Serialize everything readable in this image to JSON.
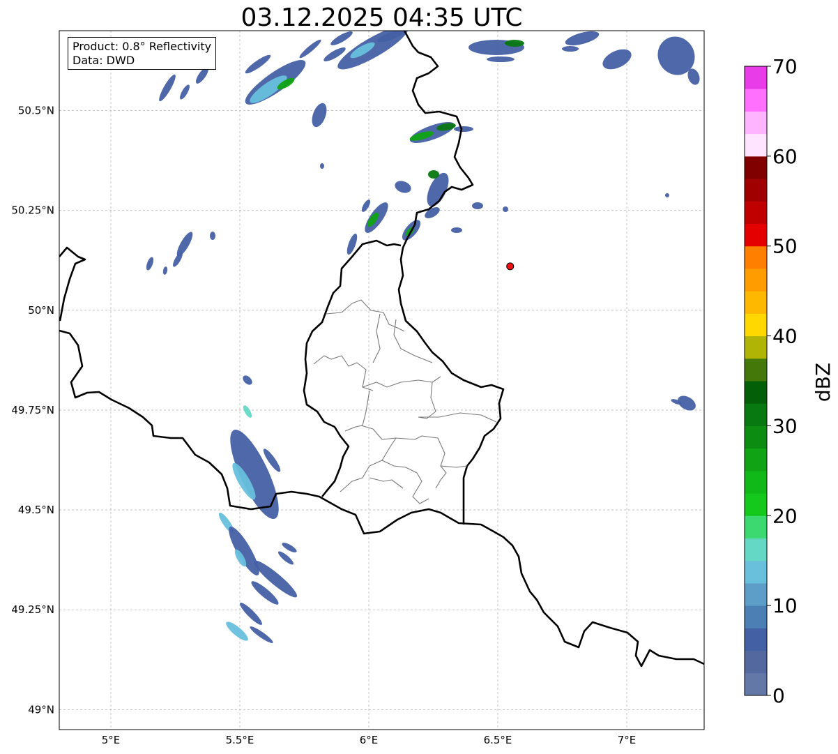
{
  "title": "03.12.2025 04:35 UTC",
  "info": {
    "product": "Product: 0.8° Reflectivity",
    "data": "Data: DWD"
  },
  "map_extent": {
    "lon": [
      4.8,
      7.3
    ],
    "lat": [
      48.95,
      50.7
    ]
  },
  "axes": {
    "x_ticks": [
      {
        "value": 5.0,
        "label": "5°E"
      },
      {
        "value": 5.5,
        "label": "5.5°E"
      },
      {
        "value": 6.0,
        "label": "6°E"
      },
      {
        "value": 6.5,
        "label": "6.5°E"
      },
      {
        "value": 7.0,
        "label": "7°E"
      }
    ],
    "y_ticks": [
      {
        "value": 49.0,
        "label": "49°N"
      },
      {
        "value": 49.25,
        "label": "49.25°N"
      },
      {
        "value": 49.5,
        "label": "49.5°N"
      },
      {
        "value": 49.75,
        "label": "49.75°N"
      },
      {
        "value": 50.0,
        "label": "50°N"
      },
      {
        "value": 50.25,
        "label": "50.25°N"
      },
      {
        "value": 50.5,
        "label": "50.5°N"
      }
    ],
    "grid": true
  },
  "marker": {
    "name": "radar-site",
    "lon": 6.548,
    "lat": 50.11,
    "color": "#ee1111"
  },
  "colorbar": {
    "label": "dBZ",
    "range": [
      0,
      70
    ],
    "tick_labels": [
      "0",
      "10",
      "20",
      "30",
      "40",
      "50",
      "60",
      "70"
    ],
    "colors": [
      "#6478a8",
      "#5468a0",
      "#4460a4",
      "#4c80b4",
      "#5c9ec8",
      "#68c0dc",
      "#64d8c4",
      "#3cd870",
      "#14c81c",
      "#10b818",
      "#10a414",
      "#0c8c10",
      "#087810",
      "#046008",
      "#447808",
      "#b0b404",
      "#ffd800",
      "#ffb800",
      "#ff9c00",
      "#ff8000",
      "#e40000",
      "#c00000",
      "#a00000",
      "#800000",
      "#ffe4ff",
      "#ffb4ff",
      "#ff70ff",
      "#e83ce8"
    ]
  }
}
